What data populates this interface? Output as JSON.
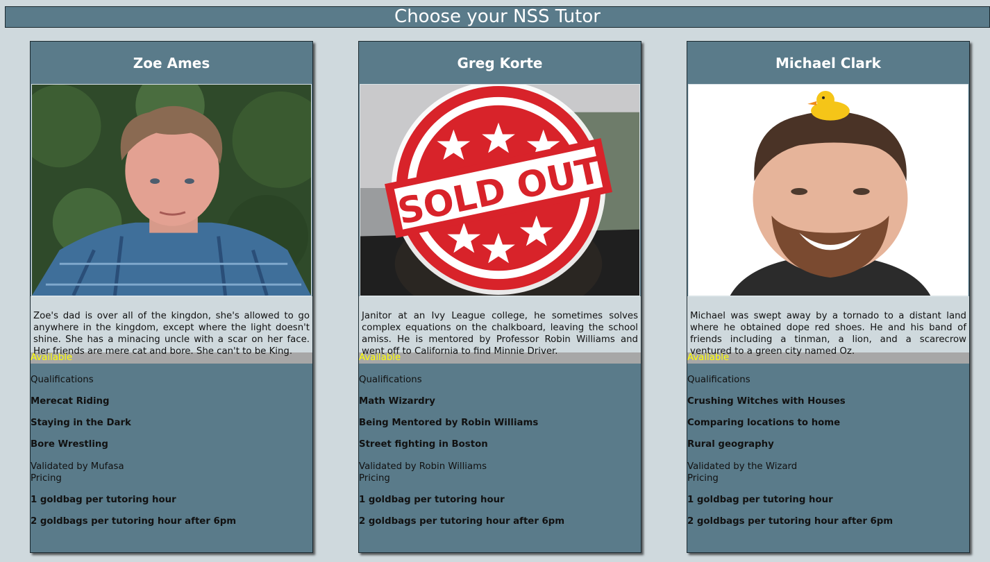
{
  "page": {
    "title": "Choose your NSS Tutor"
  },
  "tutors": [
    {
      "name": "Zoe Ames",
      "bio": "Zoe's dad is over all of the kingdon, she's allowed to go anywhere in the kingdom, except where the light doesn't shine. She has a minacing uncle with a scar on her face. Her friends are mere cat and bore. She can't to be King.",
      "status": "Available",
      "qualifications_label": "Qualifications",
      "skills": [
        "Merecat Riding",
        "Staying in the Dark",
        "Bore Wrestling"
      ],
      "validated": "Validated by Mufasa",
      "pricing_label": "Pricing",
      "prices": [
        "1 goldbag per tutoring hour",
        "2 goldbags per tutoring hour after 6pm"
      ]
    },
    {
      "name": "Greg Korte",
      "bio": "Janitor at an Ivy League college, he sometimes solves complex equations on the chalkboard, leaving the school amiss. He is mentored by Professor Robin Williams and went off to California to find Minnie Driver.",
      "status": "Available",
      "qualifications_label": "Qualifications",
      "skills": [
        "Math Wizardry",
        "Being Mentored by Robin Williams",
        "Street fighting in Boston"
      ],
      "validated": "Validated by Robin Williams",
      "pricing_label": "Pricing",
      "prices": [
        "1 goldbag per tutoring hour",
        "2 goldbags per tutoring hour after 6pm"
      ],
      "stamp_text": "SOLD OUT"
    },
    {
      "name": "Michael Clark",
      "bio": "Michael was swept away by a tornado to a distant land where he obtained dope red shoes. He and his band of friends including a tinman, a lion, and a scarecrow ventured to a green city named Oz.",
      "status": "Available",
      "qualifications_label": "Qualifications",
      "skills": [
        "Crushing Witches with Houses",
        "Comparing locations to home",
        "Rural geography"
      ],
      "validated": "Validated by the Wizard",
      "pricing_label": "Pricing",
      "prices": [
        "1 goldbag per tutoring hour",
        "2 goldbags per tutoring hour after 6pm"
      ]
    }
  ],
  "colors": {
    "background": "#cfd9dd",
    "card": "#5a7b8a",
    "status_bar": "#a7a7a7",
    "status_text": "#ffff00",
    "stamp": "#d8232a"
  }
}
